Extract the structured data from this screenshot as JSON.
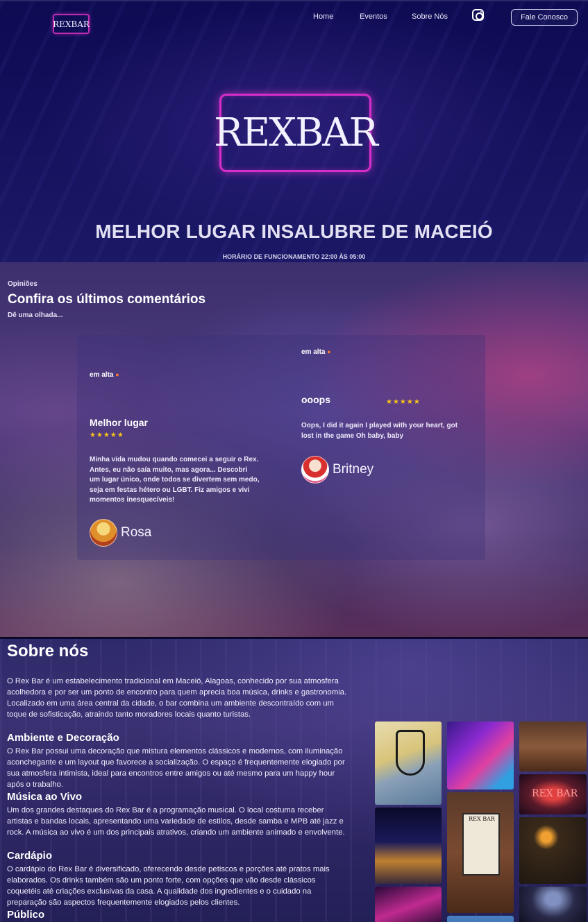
{
  "nav": {
    "logo": "REXBAR",
    "links": [
      "Home",
      "Eventos",
      "Sobre Nós"
    ],
    "instagram_icon": "instagram-icon",
    "contact_button": "Fale Conosco"
  },
  "hero": {
    "logo": "REXBAR",
    "title": "MELHOR LUGAR INSALUBRE DE MACEIÓ",
    "hours": "HORÁRIO DE FUNCIONAMENTO 22:00 ÀS 05:00"
  },
  "reviews": {
    "kicker": "Opiniões",
    "title": "Confira os últimos comentários",
    "subtitle": "Dê uma olhada...",
    "items": [
      {
        "badge": "em alta",
        "title": "Melhor lugar",
        "stars": "★★★★★",
        "text": "Minha vida mudou quando comecei a seguir o Rex. Antes, eu não saía muito, mas agora... Descobri um lugar único, onde todos se divertem sem medo, seja em festas hétero ou LGBT. Fiz amigos e vivi momentos inesquecíveis!",
        "author": "Rosa"
      },
      {
        "badge": "em alta",
        "title": "ooops",
        "stars": "★★★★★",
        "text": "Oops, I did it again I played with your heart, got lost in the game Oh baby, baby",
        "author": "Britney"
      }
    ]
  },
  "about": {
    "title": "Sobre nós",
    "intro": "O Rex Bar é um estabelecimento tradicional em Maceió, Alagoas, conhecido por sua atmosfera acolhedora e por ser um ponto de encontro para quem aprecia boa música, drinks e gastronomia. Localizado em uma área central da cidade, o bar combina um ambiente descontraído com um toque de sofisticação, atraindo tanto moradores locais quanto turistas.",
    "sections": [
      {
        "heading": "Ambiente e Decoração",
        "text": "O Rex Bar possui uma decoração que mistura elementos clássicos e modernos, com iluminação aconchegante e um layout que favorece a socialização. O espaço é frequentemente elogiado por sua atmosfera intimista, ideal para encontros entre amigos ou até mesmo para um happy hour após o trabalho."
      },
      {
        "heading": "Música ao Vivo",
        "text": "Um dos grandes destaques do Rex Bar é a programação musical. O local costuma receber artistas e bandas locais, apresentando uma variedade de estilos, desde samba e MPB até jazz e rock. A música ao vivo é um dos principais atrativos, criando um ambiente animado e envolvente."
      },
      {
        "heading": "Cardápio",
        "text": "O cardápio do Rex Bar é diversificado, oferecendo desde petiscos e porções até pratos mais elaborados. Os drinks também são um ponto forte, com opções que vão desde clássicos coquetéis até criações exclusivas da casa. A qualidade dos ingredientes e o cuidado na preparação são aspectos frequentemente elogiados pelos clientes."
      },
      {
        "heading": "Público",
        "text": ""
      }
    ],
    "gallery_signs": {
      "neon_sign": "REX BAR",
      "wall_sign": "REX BAR"
    }
  }
}
